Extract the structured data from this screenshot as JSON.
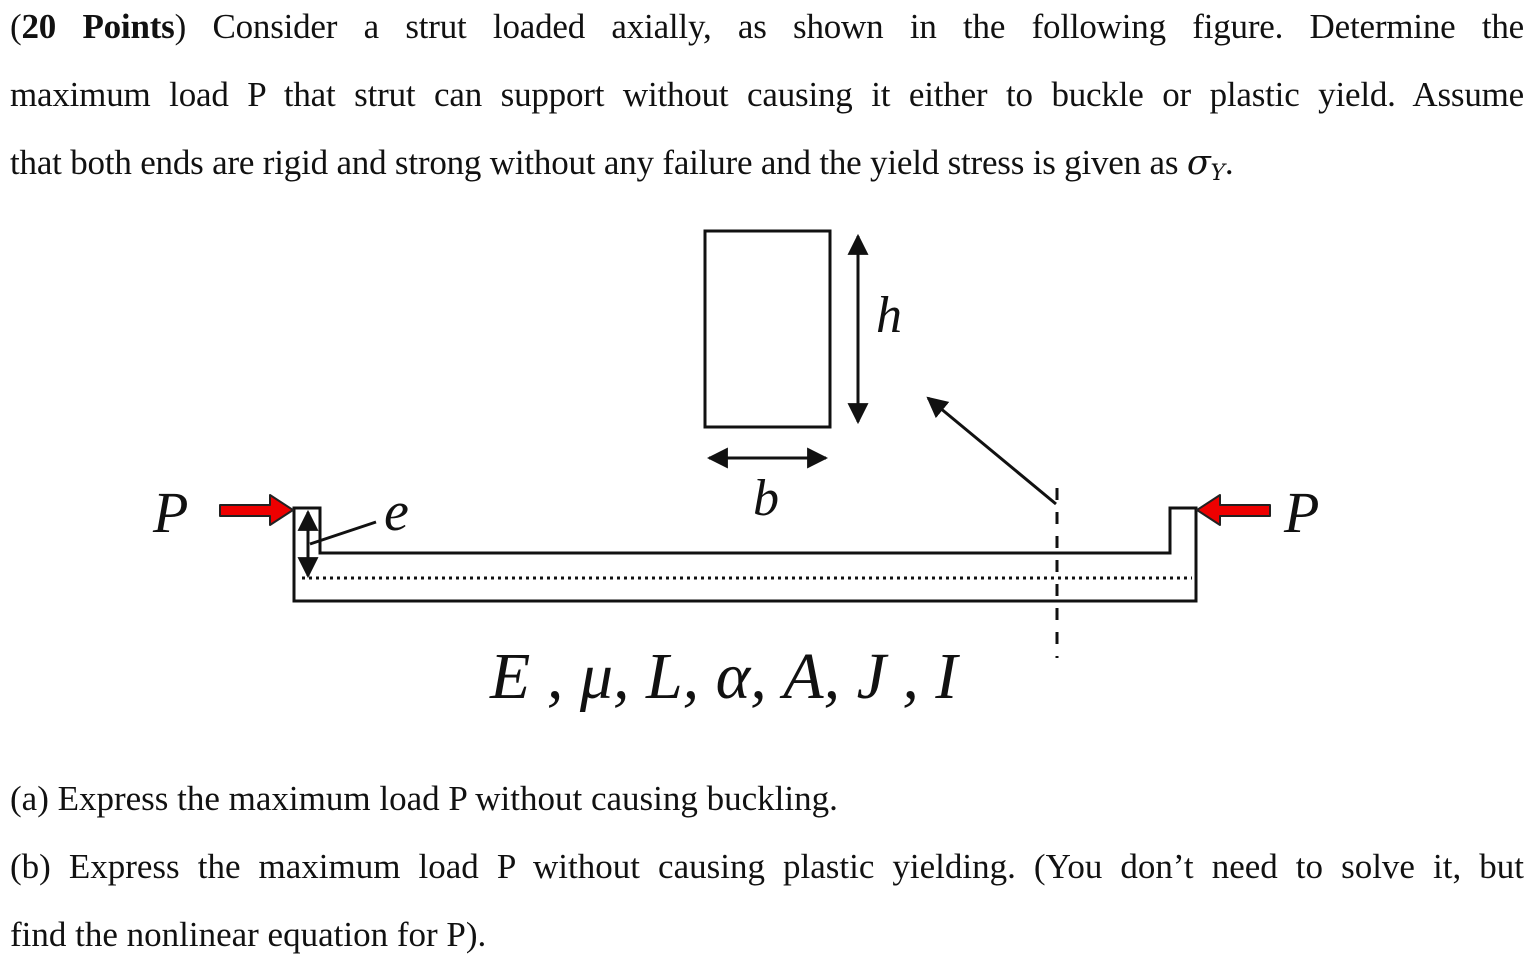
{
  "problem": {
    "points_label": "20 Points",
    "intro_lines": [
      {
        "prefix": "(",
        "bold": "20 Points",
        "suffix": ") Consider a strut loaded axially, as shown in the following figure. Determine the"
      },
      {
        "text": "maximum load P that strut can support without causing it either to buckle or plastic yield. Assume"
      },
      {
        "text": "that both ends are rigid and strong without any failure and the yield stress is given as ",
        "symbol": "σ",
        "subscript": "Y",
        "end": "."
      }
    ]
  },
  "figure": {
    "load_label_left": "P",
    "load_label_right": "P",
    "eccentricity_label": "e",
    "height_label": "h",
    "width_label": "b",
    "properties_label": "E , μ, L, α, A, J , I",
    "load_arrow_color": "#ee0000"
  },
  "questions": [
    {
      "text": "(a) Express the maximum load P without causing buckling."
    },
    {
      "text": "(b) Express the maximum load P without causing plastic yielding. (You don’t need to solve it, but"
    },
    {
      "text": "find the nonlinear equation for P)."
    }
  ]
}
